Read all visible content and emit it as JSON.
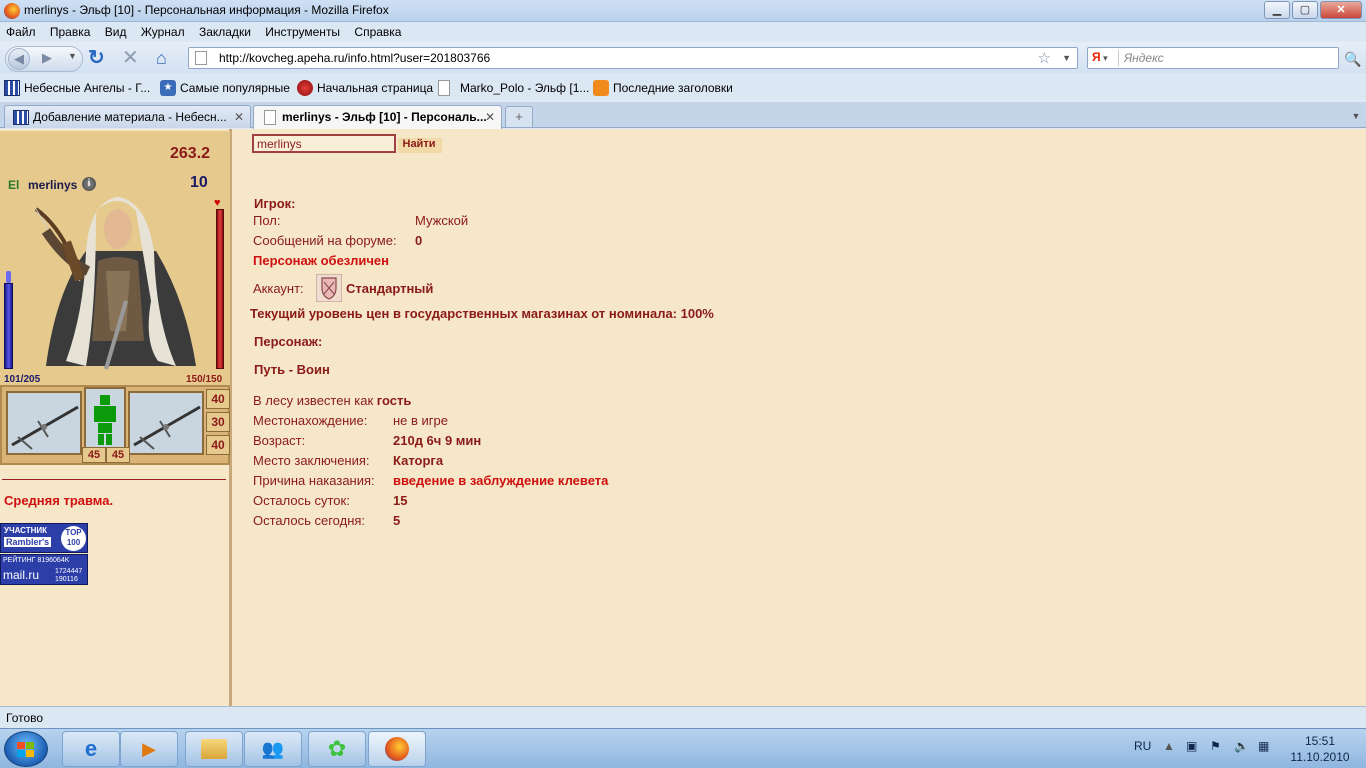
{
  "window": {
    "title": "merlinys - Эльф [10] - Персональная информация - Mozilla Firefox",
    "buttons": {
      "minimize": "▁",
      "maximize": "▢",
      "close": "✕"
    }
  },
  "menu": [
    "Файл",
    "Правка",
    "Вид",
    "Журнал",
    "Закладки",
    "Инструменты",
    "Справка"
  ],
  "nav": {
    "url": "http://kovcheg.apeha.ru/info.html?user=201803766",
    "search_placeholder": "Яндекс",
    "search_engine": "Я"
  },
  "bookmarks": [
    {
      "label": "Небесные Ангелы - Г...",
      "icon": "chart-icon"
    },
    {
      "label": "Самые популярные",
      "icon": "star-icon"
    },
    {
      "label": "Начальная страница",
      "icon": "bull-icon"
    },
    {
      "label": "Marko_Polo - Эльф [1...",
      "icon": "page-icon"
    },
    {
      "label": "Последние заголовки",
      "icon": "rss-icon"
    }
  ],
  "tabs": [
    {
      "label": "Добавление материала - Небесн...",
      "active": false
    },
    {
      "label": "merlinys - Эльф [10] - Персональ...",
      "active": true
    }
  ],
  "character": {
    "money": "263.2",
    "element": "El",
    "name": "merlinys",
    "level": "10",
    "hp": "150/150",
    "mp": "101/205",
    "hp_fraction": 1.0,
    "mp_fraction": 0.49,
    "stats_right": [
      "40",
      "30",
      "40"
    ],
    "stats_bottom": [
      "45",
      "45"
    ],
    "trauma": "Средняя травма."
  },
  "counters": {
    "top_line1": "УЧАСТНИК",
    "top_line2": "Rambler's",
    "top_badge": "TOP 100",
    "rating": "РЕЙТИНГ 8196064K",
    "mail": "mail.ru",
    "mail_nums1": "1724447",
    "mail_nums2": "190116"
  },
  "search": {
    "value": "merlinys",
    "button": "Найти"
  },
  "info": {
    "player_heading": "Игрок:",
    "gender_label": "Пол:",
    "gender_value": "Мужской",
    "forum_label": "Сообщений на форуме:",
    "forum_value": "0",
    "depersonalized": "Персонаж обезличен",
    "account_label": "Аккаунт:",
    "account_value": "Стандартный",
    "price_level": "Текущий уровень цен в государственных магазинах от номинала: 100%",
    "character_heading": "Персонаж:",
    "path": "Путь - Воин",
    "forest_label": "В лесу известен как",
    "forest_value": "гость",
    "location_label": "Местонахождение:",
    "location_value": "не в игре",
    "age_label": "Возраст:",
    "age_value": "210д 6ч 9 мин",
    "prison_label": "Место заключения:",
    "prison_value": "Каторга",
    "reason_label": "Причина наказания:",
    "reason_value": "введение в заблуждение клевета",
    "days_left_label": "Осталось суток:",
    "days_left_value": "15",
    "today_left_label": "Осталось сегодня:",
    "today_left_value": "5"
  },
  "status": "Готово",
  "taskbar": {
    "lang": "RU",
    "time": "15:51",
    "date": "11.10.2010"
  }
}
